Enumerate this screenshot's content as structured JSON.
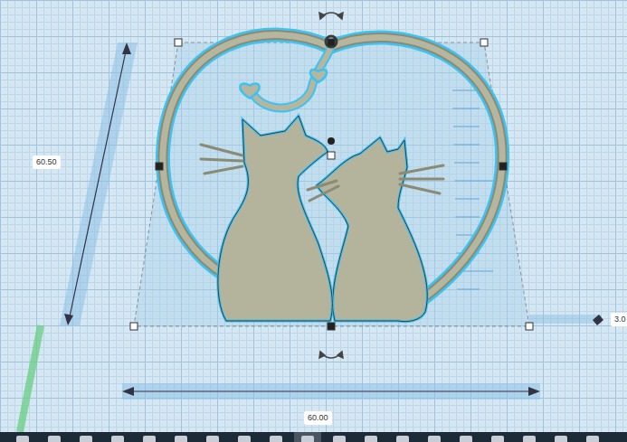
{
  "dimensions": [
    {
      "name": "height",
      "value": "60.50"
    },
    {
      "name": "width",
      "value": "60.00"
    },
    {
      "name": "depth",
      "value": "3.0"
    }
  ],
  "taskbar": {
    "buttons": [
      {
        "selected": false
      },
      {
        "selected": false
      },
      {
        "selected": false
      },
      {
        "selected": false
      },
      {
        "selected": false
      },
      {
        "selected": false
      },
      {
        "selected": false
      },
      {
        "selected": false
      },
      {
        "selected": false
      },
      {
        "selected": true
      },
      {
        "selected": false
      },
      {
        "selected": false
      },
      {
        "selected": false
      },
      {
        "selected": false
      },
      {
        "selected": false
      },
      {
        "selected": false
      },
      {
        "selected": false
      },
      {
        "selected": false
      },
      {
        "selected": false
      }
    ]
  }
}
